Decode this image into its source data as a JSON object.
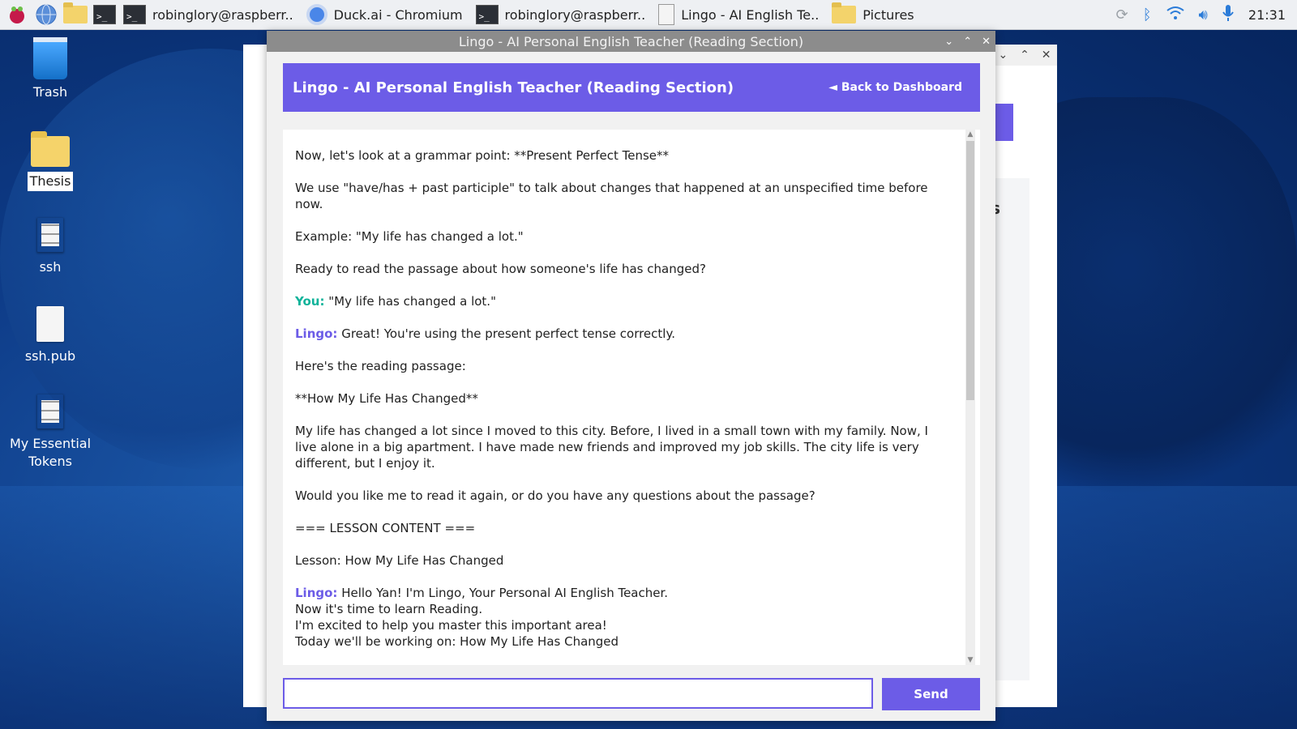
{
  "taskbar": {
    "tasks": [
      {
        "label": "robinglory@raspberr.."
      },
      {
        "label": "Duck.ai - Chromium"
      },
      {
        "label": "robinglory@raspberr.."
      },
      {
        "label": "Lingo - AI English Te.."
      },
      {
        "label": "Pictures"
      }
    ],
    "clock": "21:31"
  },
  "desktop": {
    "icons": [
      {
        "label": "Trash"
      },
      {
        "label": "Thesis"
      },
      {
        "label": "ssh"
      },
      {
        "label": "ssh.pub"
      },
      {
        "label": "My Essential Tokens"
      }
    ]
  },
  "background_window": {
    "partial_text": "es"
  },
  "window": {
    "title": "Lingo - AI Personal English Teacher (Reading Section)",
    "header_title": "Lingo - AI Personal English Teacher (Reading Section)",
    "back_label": "◄ Back to Dashboard",
    "send_label": "Send",
    "input_value": ""
  },
  "chat": {
    "messages": [
      {
        "speaker": "",
        "lines": [
          "Now, let's look at a grammar point: **Present Perfect Tense**"
        ]
      },
      {
        "speaker": "",
        "lines": [
          "We use \"have/has + past participle\" to talk about changes that happened at an unspecified time before now."
        ]
      },
      {
        "speaker": "",
        "lines": [
          "Example: \"My life has changed a lot.\""
        ]
      },
      {
        "speaker": "",
        "lines": [
          "Ready to read the passage about how someone's life has changed?"
        ]
      },
      {
        "speaker": "You:",
        "lines": [
          "\"My life has changed a lot.\""
        ]
      },
      {
        "speaker": "Lingo:",
        "lines": [
          "Great! You're using the present perfect tense correctly."
        ]
      },
      {
        "speaker": "",
        "lines": [
          "Here's the reading passage:"
        ]
      },
      {
        "speaker": "",
        "lines": [
          "**How My Life Has Changed**"
        ]
      },
      {
        "speaker": "",
        "lines": [
          "My life has changed a lot since I moved to this city. Before, I lived in a small town with my family. Now, I live alone in a big apartment. I have made new friends and improved my job skills. The city life is very different, but I enjoy it."
        ]
      },
      {
        "speaker": "",
        "lines": [
          "Would you like me to read it again, or do you have any questions about the passage?"
        ]
      },
      {
        "speaker": "",
        "lines": [
          "=== LESSON CONTENT ==="
        ]
      },
      {
        "speaker": "",
        "lines": [
          "Lesson: How My Life Has Changed"
        ]
      },
      {
        "speaker": "Lingo:",
        "lines": [
          "Hello Yan! I'm Lingo, Your Personal AI English Teacher.",
          "Now it's time to learn Reading.",
          "I'm excited to help you master this important area!",
          "Today we'll be working on: How My Life Has Changed"
        ]
      }
    ]
  }
}
